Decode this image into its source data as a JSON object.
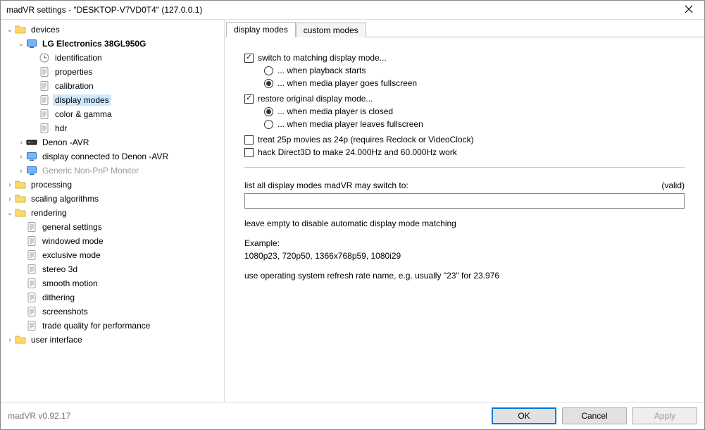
{
  "window": {
    "title": "madVR settings - \"DESKTOP-V7VD0T4\" (127.0.0.1)"
  },
  "tree": {
    "devices": "devices",
    "lg": "LG Electronics 38GL950G",
    "lg_identification": "identification",
    "lg_properties": "properties",
    "lg_calibration": "calibration",
    "lg_display_modes": "display modes",
    "lg_color_gamma": "color & gamma",
    "lg_hdr": "hdr",
    "denon": "Denon -AVR",
    "display_connected": "display connected to Denon -AVR",
    "generic": "Generic Non-PnP Monitor",
    "processing": "processing",
    "scaling": "scaling algorithms",
    "rendering": "rendering",
    "r_general": "general settings",
    "r_windowed": "windowed mode",
    "r_exclusive": "exclusive mode",
    "r_stereo": "stereo 3d",
    "r_smooth": "smooth motion",
    "r_dithering": "dithering",
    "r_screenshots": "screenshots",
    "r_trade": "trade quality for performance",
    "ui": "user interface"
  },
  "tabs": {
    "display_modes": "display modes",
    "custom_modes": "custom modes"
  },
  "form": {
    "switch_label": "switch to matching display mode...",
    "switch_opt1": "... when playback starts",
    "switch_opt2": "... when media player goes fullscreen",
    "restore_label": "restore original display mode...",
    "restore_opt1": "... when media player is closed",
    "restore_opt2": "... when media player leaves fullscreen",
    "treat25p": "treat 25p movies as 24p  (requires Reclock or VideoClock)",
    "hackd3d": "hack Direct3D to make 24.000Hz and 60.000Hz work",
    "listlabel": "list all display modes madVR may switch to:",
    "valid": "(valid)",
    "modes_value": "",
    "leave_empty": "leave empty to disable automatic display mode matching",
    "example_title": "Example:",
    "example_value": "1080p23, 720p50, 1366x768p59, 1080i29",
    "refresh_hint": "use operating system refresh rate name, e.g. usually \"23\" for 23.976"
  },
  "footer": {
    "version": "madVR v0.92.17",
    "ok": "OK",
    "cancel": "Cancel",
    "apply": "Apply"
  }
}
